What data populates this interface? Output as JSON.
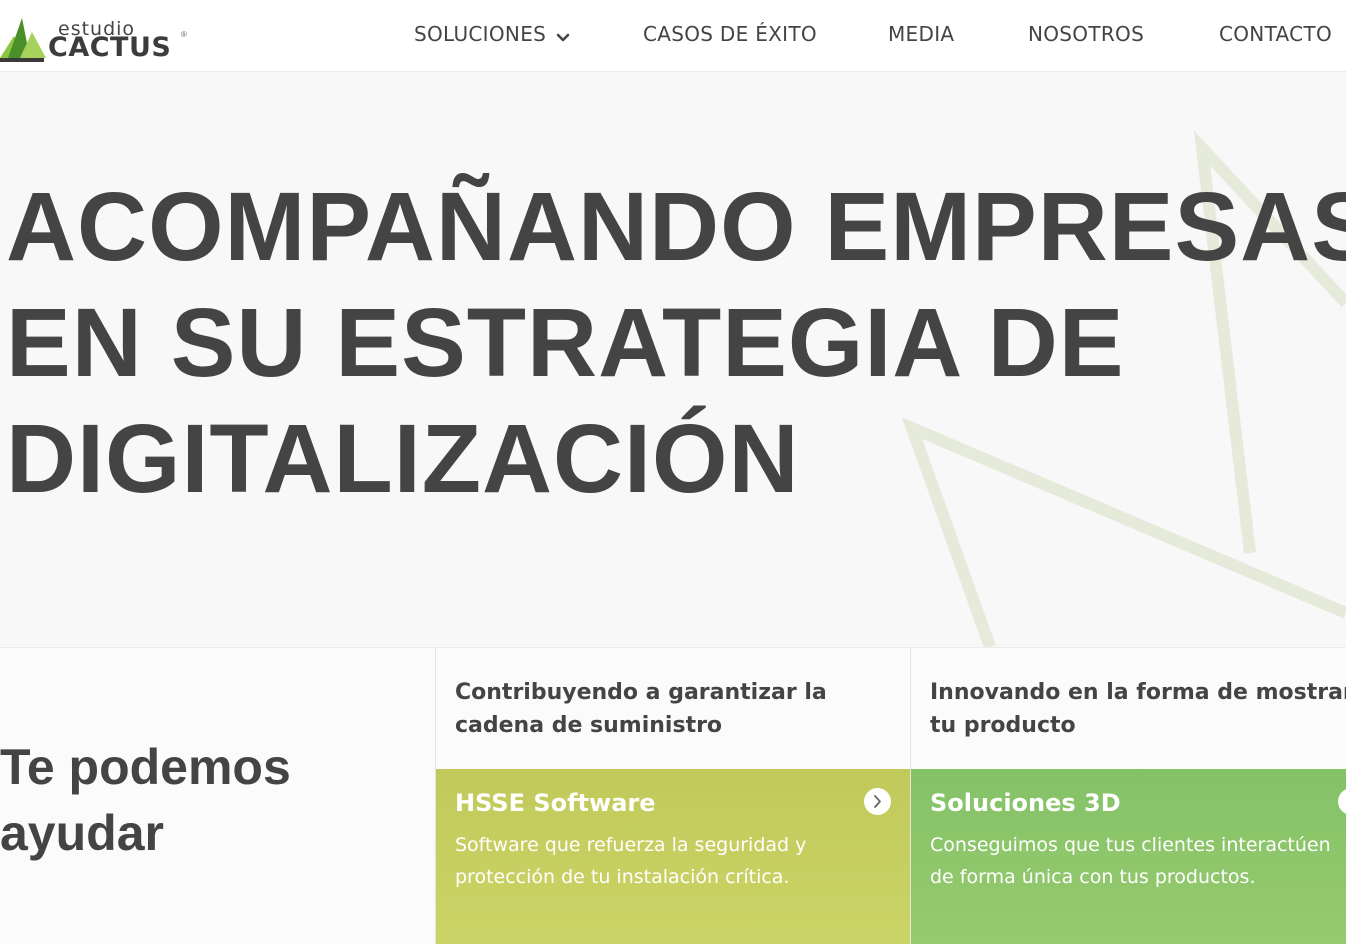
{
  "header": {
    "logo": {
      "small": "estudio",
      "brand": "CACTUS",
      "reg": "®"
    },
    "nav": [
      {
        "label": "SOLUCIONES",
        "has_dropdown": true
      },
      {
        "label": "CASOS DE ÉXITO"
      },
      {
        "label": "MEDIA"
      },
      {
        "label": "NOSOTROS"
      },
      {
        "label": "CONTACTO"
      }
    ]
  },
  "hero": {
    "title_lines": [
      "ACOMPAÑANDO EMPRESAS",
      "EN SU ESTRATEGIA DE",
      "DIGITALIZACIÓN"
    ]
  },
  "help": {
    "lines": [
      "Te podemos",
      "ayudar"
    ]
  },
  "columns": [
    {
      "heading_lines": [
        "Contribuyendo a garantizar la",
        "cadena de suministro"
      ],
      "card": {
        "title": "HSSE Software",
        "text_lines": [
          "Software que refuerza la seguridad y",
          "protección de tu instalación crítica."
        ],
        "icon": "chevron-right-icon",
        "color": "#c5cd5e"
      }
    },
    {
      "heading_lines": [
        "Innovando en la forma de mostrar",
        "tu producto"
      ],
      "card": {
        "title": "Soluciones 3D",
        "text_lines": [
          "Conseguimos que tus clientes interactúen",
          "de forma única con tus productos."
        ],
        "icon": "chevron-right-icon",
        "color": "#8dc66b"
      }
    }
  ],
  "colors": {
    "text": "#444444",
    "brand_green": "#8cc63f",
    "card_lime": "#c5cd5e",
    "card_green": "#8dc66b"
  }
}
